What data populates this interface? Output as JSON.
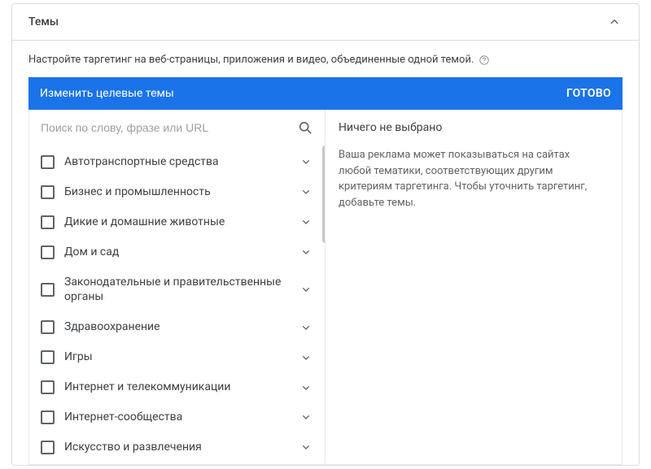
{
  "panel": {
    "title": "Темы",
    "description": "Настройте таргетинг на веб-страницы, приложения и видео, объединенные одной темой."
  },
  "blueBar": {
    "label": "Изменить целевые темы",
    "done": "ГОТОВО"
  },
  "search": {
    "placeholder": "Поиск по слову, фразе или URL"
  },
  "topics": [
    {
      "label": "Автотранспортные средства"
    },
    {
      "label": "Бизнес и промышленность"
    },
    {
      "label": "Дикие и домашние животные"
    },
    {
      "label": "Дом и сад"
    },
    {
      "label": "Законодательные и правительственные органы"
    },
    {
      "label": "Здравоохранение"
    },
    {
      "label": "Игры"
    },
    {
      "label": "Интернет и телекоммуникации"
    },
    {
      "label": "Интернет-сообщества"
    },
    {
      "label": "Искусство и развлечения"
    }
  ],
  "rightPanel": {
    "title": "Ничего не выбрано",
    "paragraph": "Ваша реклама может показываться на сайтах любой тематики, соответствующих другим критериям таргетинга. Чтобы уточнить таргетинг, добавьте темы."
  }
}
